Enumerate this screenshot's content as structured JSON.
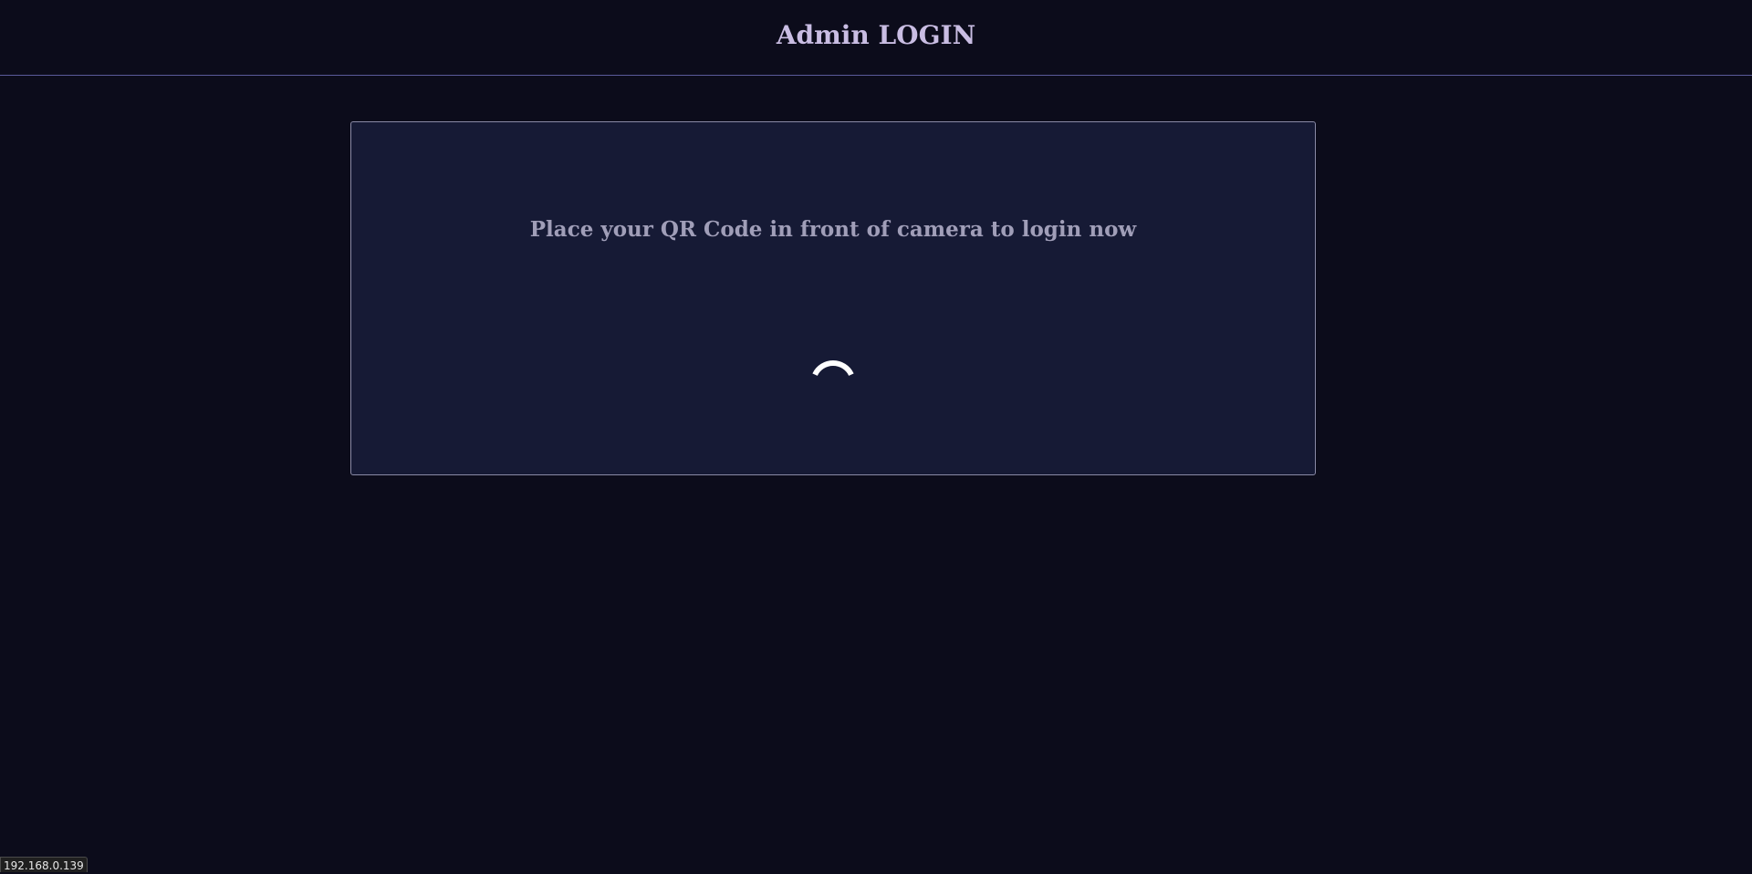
{
  "header": {
    "title": "Admin LOGIN"
  },
  "qr_panel": {
    "instruction": "Place your QR Code in front of camera to login now",
    "status": "loading",
    "spinner_icon": "loading-spinner-icon"
  },
  "status_bar": {
    "url": "192.168.0.139"
  },
  "colors": {
    "background": "#0c0c1b",
    "panel": "#161a35",
    "title_text": "#c9bde3",
    "instruction_text": "#a09eb8",
    "divider": "#5a5a9a",
    "spinner": "#ffffff"
  }
}
